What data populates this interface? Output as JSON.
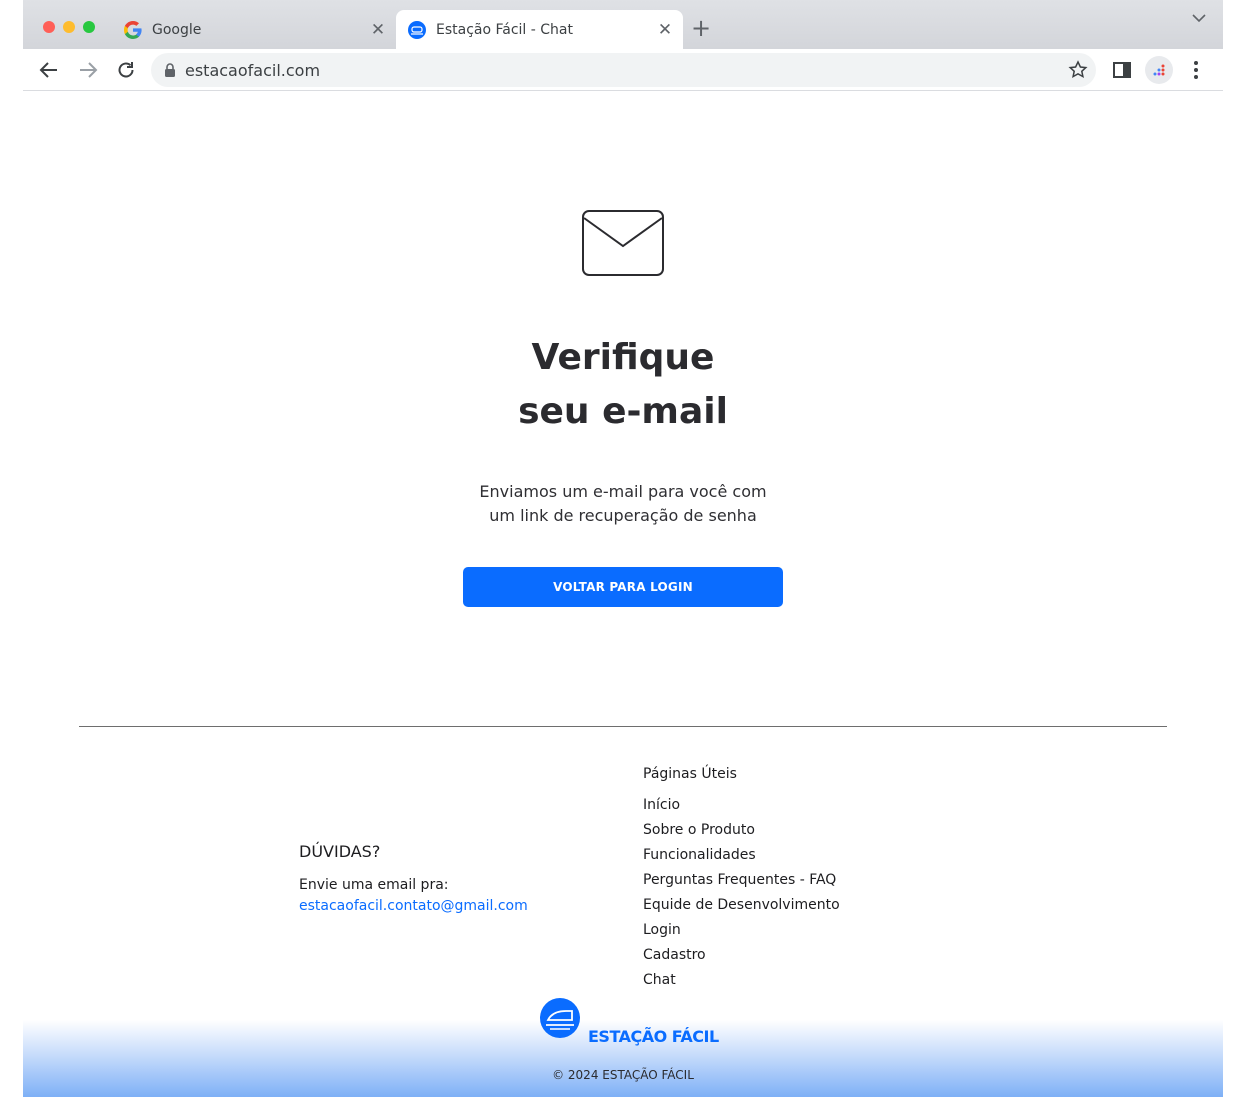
{
  "browser": {
    "tabs": [
      {
        "title": "Google",
        "favicon": "google-g-icon",
        "active": false
      },
      {
        "title": "Estação Fácil - Chat",
        "favicon": "estacao-facil-icon",
        "active": true
      }
    ],
    "new_tab_icon": "plus-icon",
    "url": "estacaofacil.com"
  },
  "main": {
    "icon": "envelope-icon",
    "title_line1": "Verifique",
    "title_line2": "seu e-mail",
    "description_line1": "Enviamos um e-mail para você com",
    "description_line2": "um link de recuperação de senha",
    "button_label": "VOLTAR PARA LOGIN",
    "accent_color": "#0a6cff"
  },
  "footer": {
    "questions_title": "DÚVIDAS?",
    "questions_text": "Envie uma email pra:",
    "contact_email": "estacaofacil.contato@gmail.com",
    "links_title": "Páginas Úteis",
    "links": [
      "Início",
      "Sobre o Produto",
      "Funcionalidades",
      "Perguntas Frequentes - FAQ",
      "Equide de Desenvolvimento",
      "Login",
      "Cadastro",
      "Chat"
    ],
    "brand_name": "ESTAÇÃO FÁCIL",
    "copyright": "© 2024 ESTAÇÃO FÁCIL"
  }
}
